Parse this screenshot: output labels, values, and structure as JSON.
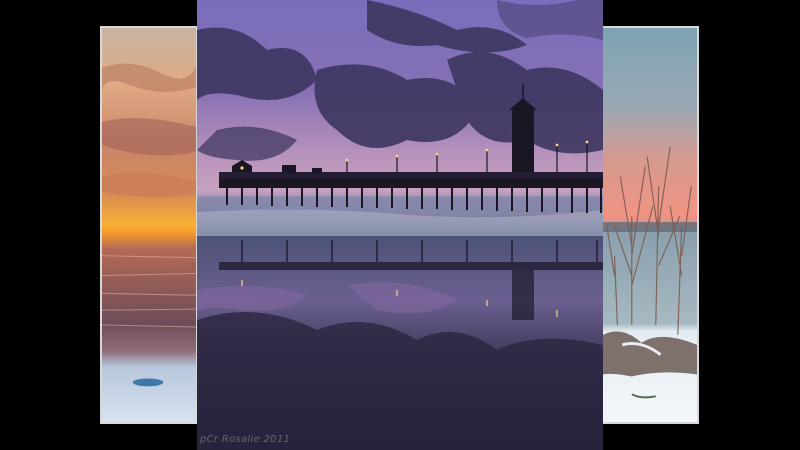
{
  "slideshow": {
    "background": "#000000",
    "slides": [
      {
        "id": "left",
        "subject": "sunset-over-ocean"
      },
      {
        "id": "center",
        "subject": "pier-at-dusk-reflection"
      },
      {
        "id": "right",
        "subject": "snowy-shore-with-bare-shrubs"
      }
    ],
    "watermark": "pCr Rosalie 2011"
  },
  "colors": {
    "sky_purple": "#6a5a9c",
    "cloud_dark": "#3d3660",
    "sunset_orange": "#f39a2c",
    "frame_border": "#d8d8d8"
  }
}
